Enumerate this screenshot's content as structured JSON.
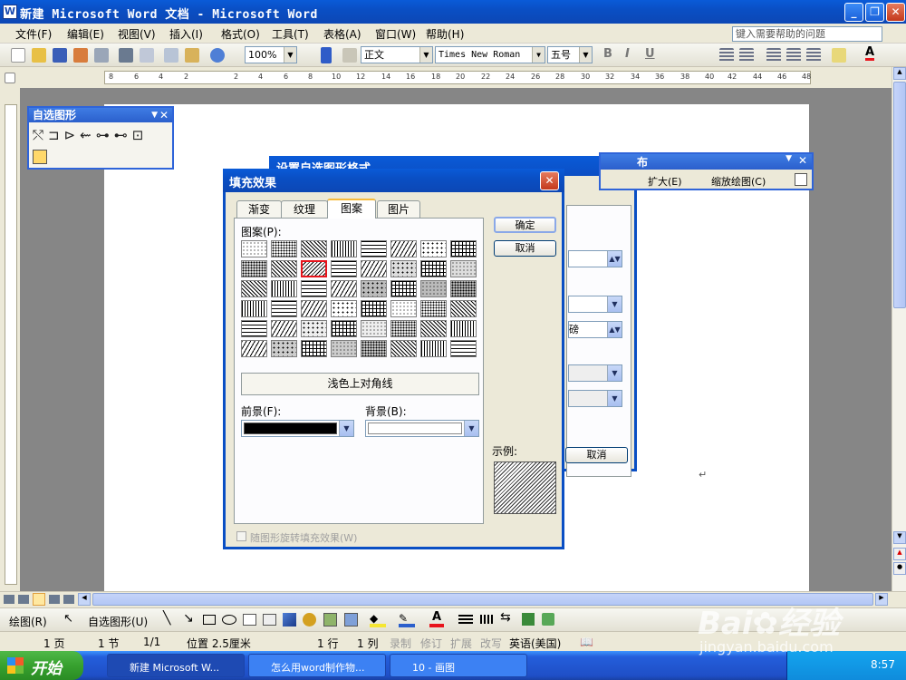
{
  "window": {
    "title": "新建 Microsoft Word 文档 - Microsoft Word",
    "app_icon": "W"
  },
  "menu": {
    "items": [
      "文件(F)",
      "编辑(E)",
      "视图(V)",
      "插入(I)",
      "格式(O)",
      "工具(T)",
      "表格(A)",
      "窗口(W)",
      "帮助(H)"
    ],
    "help_placeholder": "键入需要帮助的问题"
  },
  "toolbar": {
    "zoom": "100%",
    "style": "正文",
    "font": "Times New Roman",
    "size": "五号",
    "bold": "B",
    "italic": "I",
    "underline": "U",
    "font_color_glyph": "A"
  },
  "ruler": {
    "ticks": [
      "8",
      "6",
      "4",
      "2",
      "2",
      "4",
      "6",
      "8",
      "10",
      "12",
      "14",
      "16",
      "18",
      "20",
      "22",
      "24",
      "26",
      "28",
      "30",
      "32",
      "34",
      "36",
      "38",
      "40",
      "42",
      "44",
      "46",
      "48"
    ]
  },
  "autoshapes": {
    "title": "自选图形"
  },
  "back_dialog": {
    "title": "设置自选图形格式",
    "cancel": "取消",
    "field_value": "磅"
  },
  "layout_toolbar": {
    "title": "布",
    "expand": "扩大(E)",
    "scale": "缩放绘图(C)"
  },
  "fill_dialog": {
    "title": "填充效果",
    "tabs": [
      "渐变",
      "纹理",
      "图案",
      "图片"
    ],
    "selected_tab": "图案",
    "pattern_label": "图案(P):",
    "selected_pattern_name": "浅色上对角线",
    "foreground_label": "前景(F):",
    "background_label": "背景(B):",
    "sample_label": "示例:",
    "ok": "确定",
    "cancel": "取消",
    "rotate_checkbox": "随图形旋转填充效果(W)",
    "foreground_color": "#000000",
    "background_color": "#ffffff"
  },
  "drawing_toolbar": {
    "draw": "绘图(R)",
    "autoshapes": "自选图形(U)"
  },
  "status": {
    "page": "1 页",
    "section": "1 节",
    "pages": "1/1",
    "position": "位置 2.5厘米",
    "line": "1 行",
    "col": "1 列",
    "rec": "录制",
    "trk": "修订",
    "ext": "扩展",
    "ovr": "改写",
    "lang": "英语(美国)"
  },
  "taskbar": {
    "start": "开始",
    "tasks": [
      "新建 Microsoft W...",
      "怎么用word制作物...",
      "10 - 画图"
    ],
    "time": "8:57"
  },
  "colors": {
    "xp_blue": "#0a4fc4",
    "highlight_red": "#e8141c"
  }
}
